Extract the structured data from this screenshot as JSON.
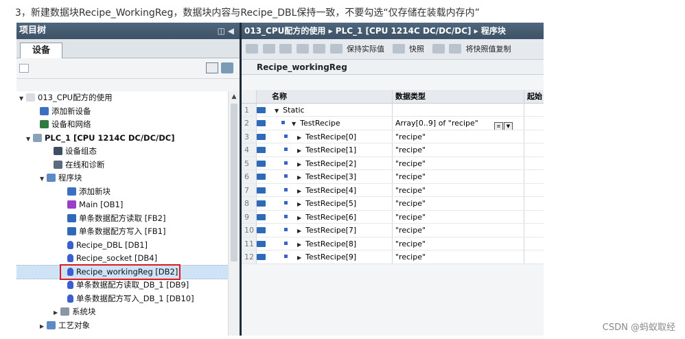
{
  "caption": "3，新建数据块Recipe_WorkingReg，数据块内容与Recipe_DBL保持一致，不要勾选“仅存储在装载内存内”",
  "watermark": "CSDN @蚂蚁取经",
  "left_panel": {
    "title": "项目树",
    "tab": "设备",
    "tree": [
      {
        "label": "013_CPU配方的使用",
        "indent": 0,
        "twisty": "▼",
        "icon": "project-icon",
        "color": "#d9dde2"
      },
      {
        "label": "添加新设备",
        "indent": 1,
        "twisty": "",
        "icon": "add-device-icon",
        "color": "#3b6fc2"
      },
      {
        "label": "设备和网络",
        "indent": 1,
        "twisty": "",
        "icon": "network-icon",
        "color": "#2f7a3f"
      },
      {
        "label": "PLC_1 [CPU 1214C DC/DC/DC]",
        "indent": 0.5,
        "twisty": "▼",
        "icon": "plc-icon",
        "color": "#8aa2b8",
        "bold": true
      },
      {
        "label": "设备组态",
        "indent": 2,
        "twisty": "",
        "icon": "device-config-icon",
        "color": "#3d4f63"
      },
      {
        "label": "在线和诊断",
        "indent": 2,
        "twisty": "",
        "icon": "diagnostics-icon",
        "color": "#5a6b7d"
      },
      {
        "label": "程序块",
        "indent": 1.5,
        "twisty": "▼",
        "icon": "program-blocks-icon",
        "color": "#5b8ac4"
      },
      {
        "label": "添加新块",
        "indent": 3,
        "twisty": "",
        "icon": "add-block-icon",
        "color": "#3b6fc2"
      },
      {
        "label": "Main [OB1]",
        "indent": 3,
        "twisty": "",
        "icon": "ob-icon",
        "color": "#9b3fc7"
      },
      {
        "label": "单条数据配方读取 [FB2]",
        "indent": 3,
        "twisty": "",
        "icon": "fb-icon",
        "color": "#2f6ab8"
      },
      {
        "label": "单条数据配方写入 [FB1]",
        "indent": 3,
        "twisty": "",
        "icon": "fb-icon",
        "color": "#2f6ab8"
      },
      {
        "label": "Recipe_DBL [DB1]",
        "indent": 3,
        "twisty": "",
        "icon": "db-icon",
        "color": "#3a5fd0"
      },
      {
        "label": "Recipe_socket [DB4]",
        "indent": 3,
        "twisty": "",
        "icon": "db-icon",
        "color": "#3a5fd0"
      },
      {
        "label": "Recipe_workingReg [DB2]",
        "indent": 3,
        "twisty": "",
        "icon": "db-icon",
        "color": "#3a5fd0",
        "selected": true
      },
      {
        "label": "单条数据配方读取_DB_1 [DB9]",
        "indent": 3,
        "twisty": "",
        "icon": "db-icon",
        "color": "#3a5fd0"
      },
      {
        "label": "单条数据配方写入_DB_1 [DB10]",
        "indent": 3,
        "twisty": "",
        "icon": "db-icon",
        "color": "#3a5fd0"
      },
      {
        "label": "系统块",
        "indent": 2.5,
        "twisty": "▶",
        "icon": "system-blocks-icon",
        "color": "#8a96a3"
      },
      {
        "label": "工艺对象",
        "indent": 1.5,
        "twisty": "▶",
        "icon": "tech-objects-icon",
        "color": "#5b8ac4"
      }
    ]
  },
  "right_panel": {
    "breadcrumb": "013_CPU配方的使用 ▸ PLC_1 [CPU 1214C DC/DC/DC] ▸ 程序块",
    "toolbar": {
      "keep_actual": "保持实际值",
      "snapshot": "快照",
      "snapshot_to_start": "将快照值复制"
    },
    "db_name": "Recipe_workingReg",
    "columns": {
      "name": "名称",
      "type": "数据类型",
      "start": "起始"
    },
    "rows": [
      {
        "num": "1",
        "name": "Static",
        "type": "",
        "level": 0,
        "twisty": "▼",
        "bullet": false
      },
      {
        "num": "2",
        "name": "TestRecipe",
        "type": "Array[0..9] of \"recipe\"",
        "level": 1,
        "twisty": "▼",
        "bullet": true,
        "dropdown": true
      },
      {
        "num": "3",
        "name": "TestRecipe[0]",
        "type": "\"recipe\"",
        "level": 2,
        "twisty": "▶",
        "bullet": true
      },
      {
        "num": "4",
        "name": "TestRecipe[1]",
        "type": "\"recipe\"",
        "level": 2,
        "twisty": "▶",
        "bullet": true
      },
      {
        "num": "5",
        "name": "TestRecipe[2]",
        "type": "\"recipe\"",
        "level": 2,
        "twisty": "▶",
        "bullet": true
      },
      {
        "num": "6",
        "name": "TestRecipe[3]",
        "type": "\"recipe\"",
        "level": 2,
        "twisty": "▶",
        "bullet": true
      },
      {
        "num": "7",
        "name": "TestRecipe[4]",
        "type": "\"recipe\"",
        "level": 2,
        "twisty": "▶",
        "bullet": true
      },
      {
        "num": "8",
        "name": "TestRecipe[5]",
        "type": "\"recipe\"",
        "level": 2,
        "twisty": "▶",
        "bullet": true
      },
      {
        "num": "9",
        "name": "TestRecipe[6]",
        "type": "\"recipe\"",
        "level": 2,
        "twisty": "▶",
        "bullet": true
      },
      {
        "num": "10",
        "name": "TestRecipe[7]",
        "type": "\"recipe\"",
        "level": 2,
        "twisty": "▶",
        "bullet": true
      },
      {
        "num": "11",
        "name": "TestRecipe[8]",
        "type": "\"recipe\"",
        "level": 2,
        "twisty": "▶",
        "bullet": true
      },
      {
        "num": "12",
        "name": "TestRecipe[9]",
        "type": "\"recipe\"",
        "level": 2,
        "twisty": "▶",
        "bullet": true
      }
    ]
  },
  "colors": {
    "title_bar": "#3d5266",
    "highlight_box": "#e01818",
    "db_icon": "#2f6ab8"
  }
}
